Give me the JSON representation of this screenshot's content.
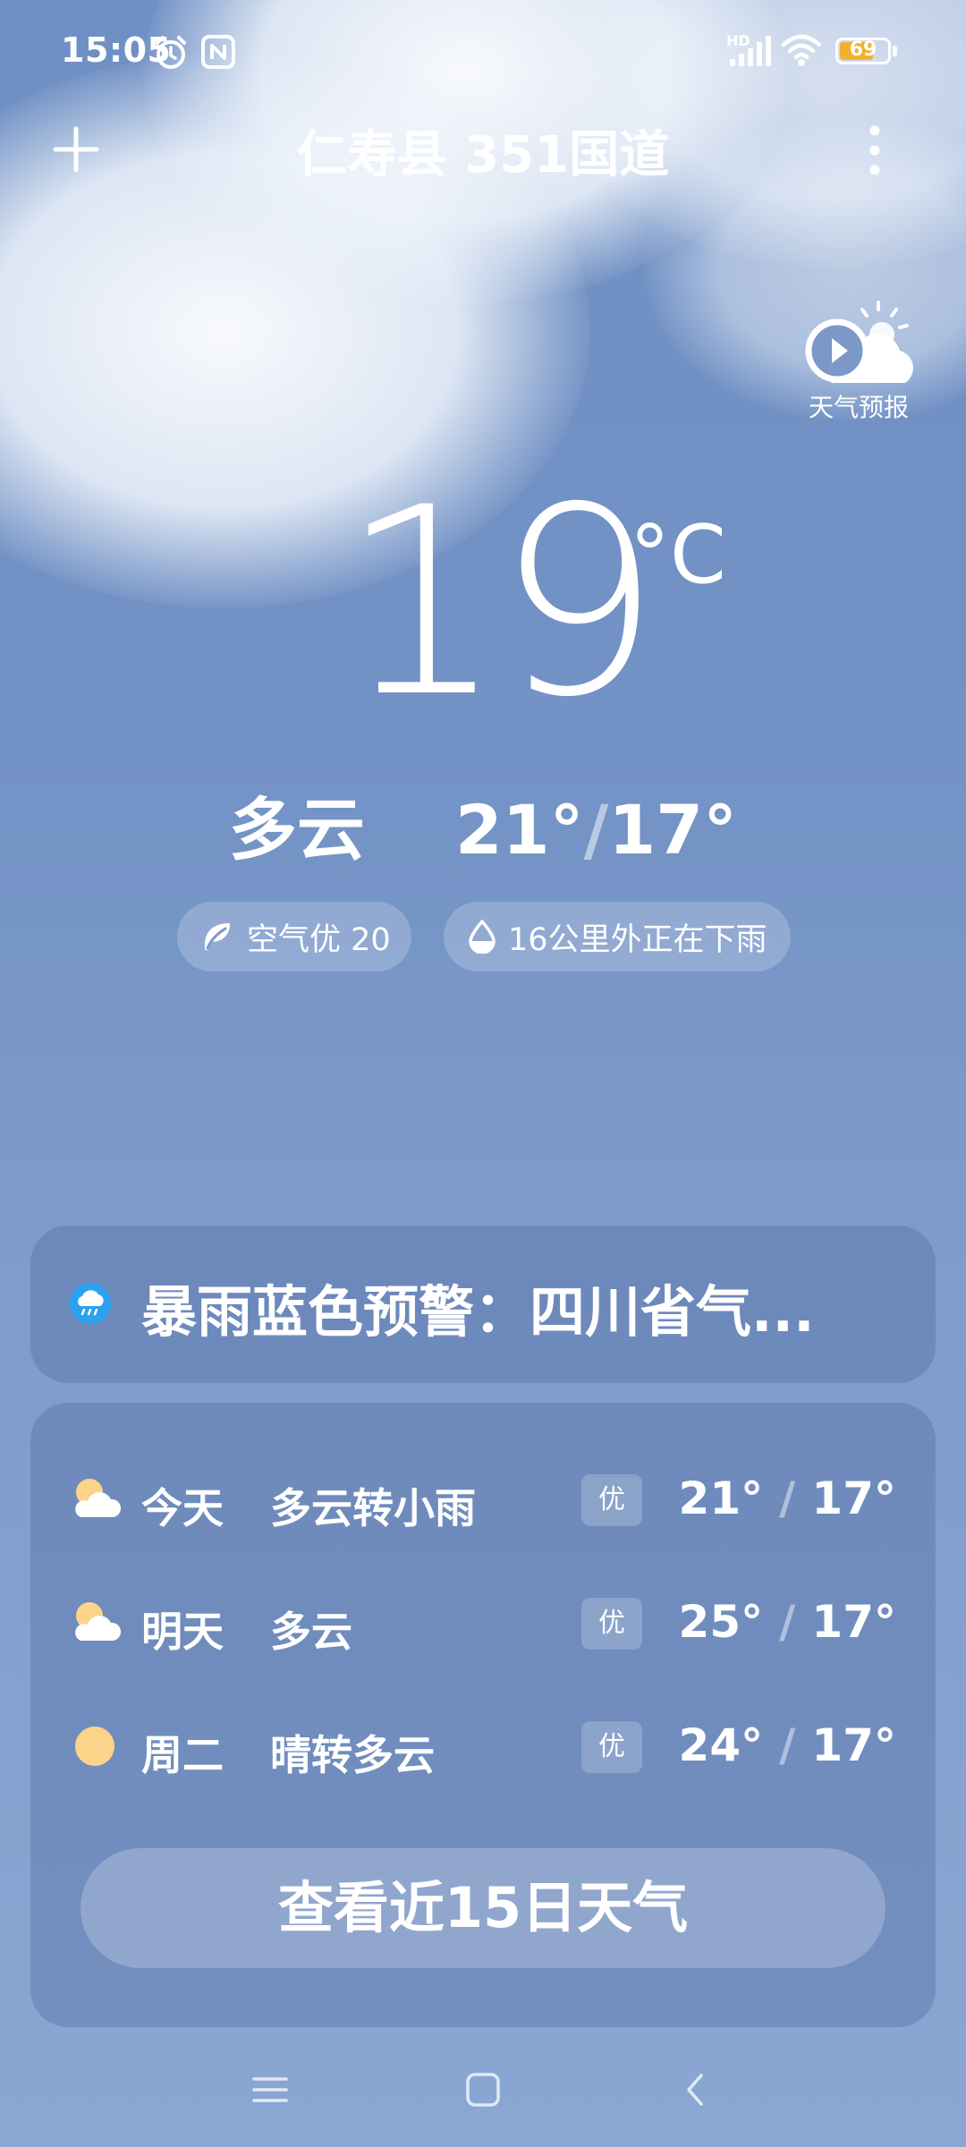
{
  "status_bar": {
    "time": "15:05",
    "network_label": "HD",
    "battery": 69
  },
  "header": {
    "title": "仁寿县 351国道",
    "forecast_video_label": "天气预报"
  },
  "current": {
    "temperature": "19",
    "unit": "°C",
    "condition": "多云",
    "high": "21°",
    "low": "17°",
    "range_separator": "/"
  },
  "chips": [
    {
      "icon": "leaf-icon",
      "label": "空气优 20"
    },
    {
      "icon": "raindrop-icon",
      "label": "16公里外正在下雨"
    }
  ],
  "alert": {
    "icon": "rain-warning-icon",
    "text": "暴雨蓝色预警：四川省气..."
  },
  "forecast": {
    "days": [
      {
        "day": "今天",
        "condition": "多云转小雨",
        "icon": "partly-cloudy-icon",
        "aqi": "优",
        "high": "21°",
        "low": "17°",
        "separator": "/"
      },
      {
        "day": "明天",
        "condition": "多云",
        "icon": "partly-cloudy-icon",
        "aqi": "优",
        "high": "25°",
        "low": "17°",
        "separator": "/"
      },
      {
        "day": "周二",
        "condition": "晴转多云",
        "icon": "sun-icon",
        "aqi": "优",
        "high": "24°",
        "low": "17°",
        "separator": "/"
      }
    ],
    "cta_label": "查看近15日天气"
  },
  "colors": {
    "background": "#7392c5",
    "battery": "#f3b02c",
    "alert_icon": "#2aa2f0",
    "sun": "#fbd48a"
  }
}
